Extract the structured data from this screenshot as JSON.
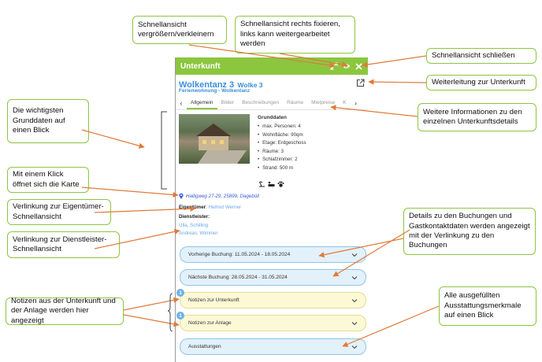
{
  "panel": {
    "header_title": "Unterkunft",
    "unit_name": "Wolkentanz 3",
    "unit_name_suffix": "Wolke 3",
    "unit_type": "Ferienwohnung - Wolkentanz",
    "tabs": [
      "Allgemein",
      "Bilder",
      "Beschreibungen",
      "Räume",
      "Mietpreise",
      "K"
    ],
    "active_tab": "Allgemein",
    "grunddaten": {
      "heading": "Grunddaten",
      "items": [
        "max. Personen: 4",
        "Wohnfläche: 90qm",
        "Etage: Erdgeschoss",
        "Räume: 3",
        "Schlafzimmer: 2",
        "Strand: 500 m"
      ]
    },
    "address": "Halligweg 27-29, 25899, Dagebüll",
    "owner_label": "Eigentümer",
    "owner_name": "Helmut Werner",
    "provider_label": "Dienstleister",
    "providers": [
      "Ulla, Schilling",
      "Andreas, Wimmer"
    ],
    "accordions": [
      {
        "label": "Vorherige Buchung: 11.05.2024 - 18.05.2024",
        "style": "blue"
      },
      {
        "label": "Nächste Buchung: 28.05.2024 - 31.05.2024",
        "style": "blue"
      },
      {
        "label": "Notizen zur Unterkunft",
        "style": "yellow",
        "badge": "1"
      },
      {
        "label": "Notizen zur Anlage",
        "style": "yellow",
        "badge": "1"
      },
      {
        "label": "Ausstattungen",
        "style": "blue"
      }
    ],
    "icons": {
      "zoom": "expand-icon",
      "pin": "eye-icon",
      "close": "close-icon",
      "external": "external-link-icon",
      "location": "map-pin-icon",
      "accordion": "chevron-down-icon"
    },
    "colors": {
      "header": "#8cc63f",
      "title": "#3b8ed8",
      "accent_blue": "#e3f1fb",
      "accent_yellow": "#fdf9d6"
    }
  },
  "callouts": {
    "zoom": "Schnellansicht vergrößern/verkleinern",
    "pin": "Schnellansicht rechts fixieren, links kann weitergearbeitet werden",
    "close": "Schnellansicht schließen",
    "redirect": "Weiterleitung zur Unterkunft",
    "basics": "Die wichtigsten Grunddaten auf einen Blick",
    "details": "Weitere Informationen zu den einzelnen Unterkunftsdetails",
    "map": "Mit einem Klick öffnet sich die Karte",
    "owner": "Verlinkung zur Eigentümer-Schnellansicht",
    "provider": "Verlinkung zur Dienstleister-Schnellansicht",
    "bookings": "Details zu den Buchungen und Gastkontaktdaten werden angezeigt mit der Verlinkung zu den Buchungen",
    "notes": "Notizen aus der Unterkunft und der Anlage werden hier angezeigt",
    "equipment": "Alle ausgefüllten Ausstattungsmerkmale auf einen Blick"
  }
}
